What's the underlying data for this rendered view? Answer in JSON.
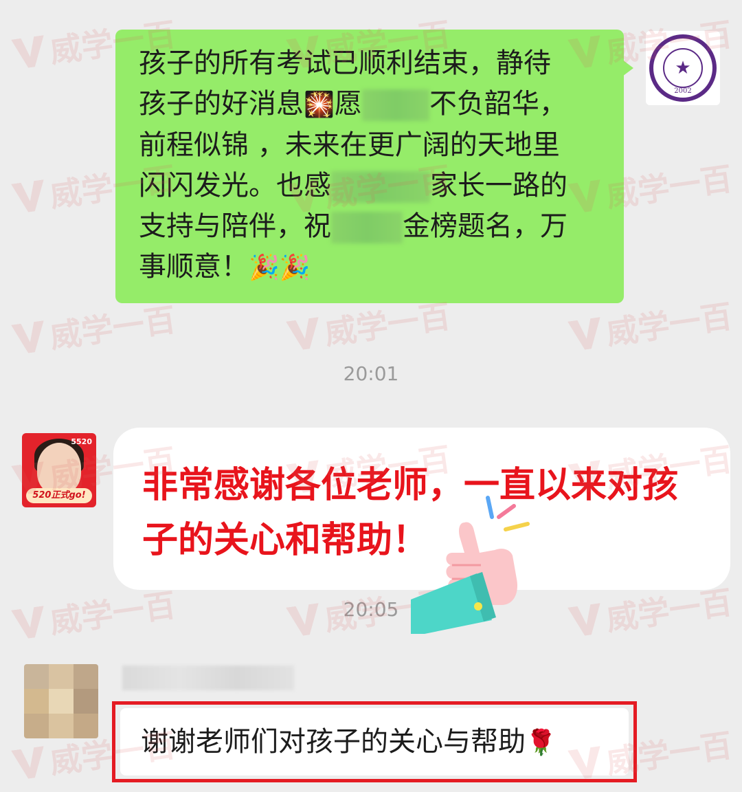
{
  "watermark": {
    "text": "威学一百"
  },
  "messages": {
    "school_message": {
      "line1": "孩子的所有考试已顺利结束，静待",
      "line2a": "孩子的好消息",
      "line2_emoji": "🎇",
      "line2b": "愿",
      "line2c": "不负韶华，",
      "line3": "前程似锦 ，未来在更广阔的天地里",
      "line4a": "闪闪发光。也感",
      "line4b": "家长一路的",
      "line5a": "支持与陪伴，祝",
      "line5b": "金榜题名，万",
      "line6": "事顺意！",
      "line6_emoji": "🎉🎉",
      "avatar_year": "2002"
    },
    "time1": "20:01",
    "parent_message": {
      "line1": "非常感谢各位老师，一直以来对孩",
      "line2": "子的关心和帮助！",
      "avatar_badge": "520正式go!",
      "avatar_corner": "5520"
    },
    "time2": "20:05",
    "last_message": {
      "text": "谢谢老师们对孩子的关心与帮助",
      "emoji": "🌹"
    }
  },
  "colors": {
    "background": "#ededed",
    "sent_bubble": "#95ec69",
    "received_bubble": "#ffffff",
    "highlight_red": "#e8141c"
  }
}
